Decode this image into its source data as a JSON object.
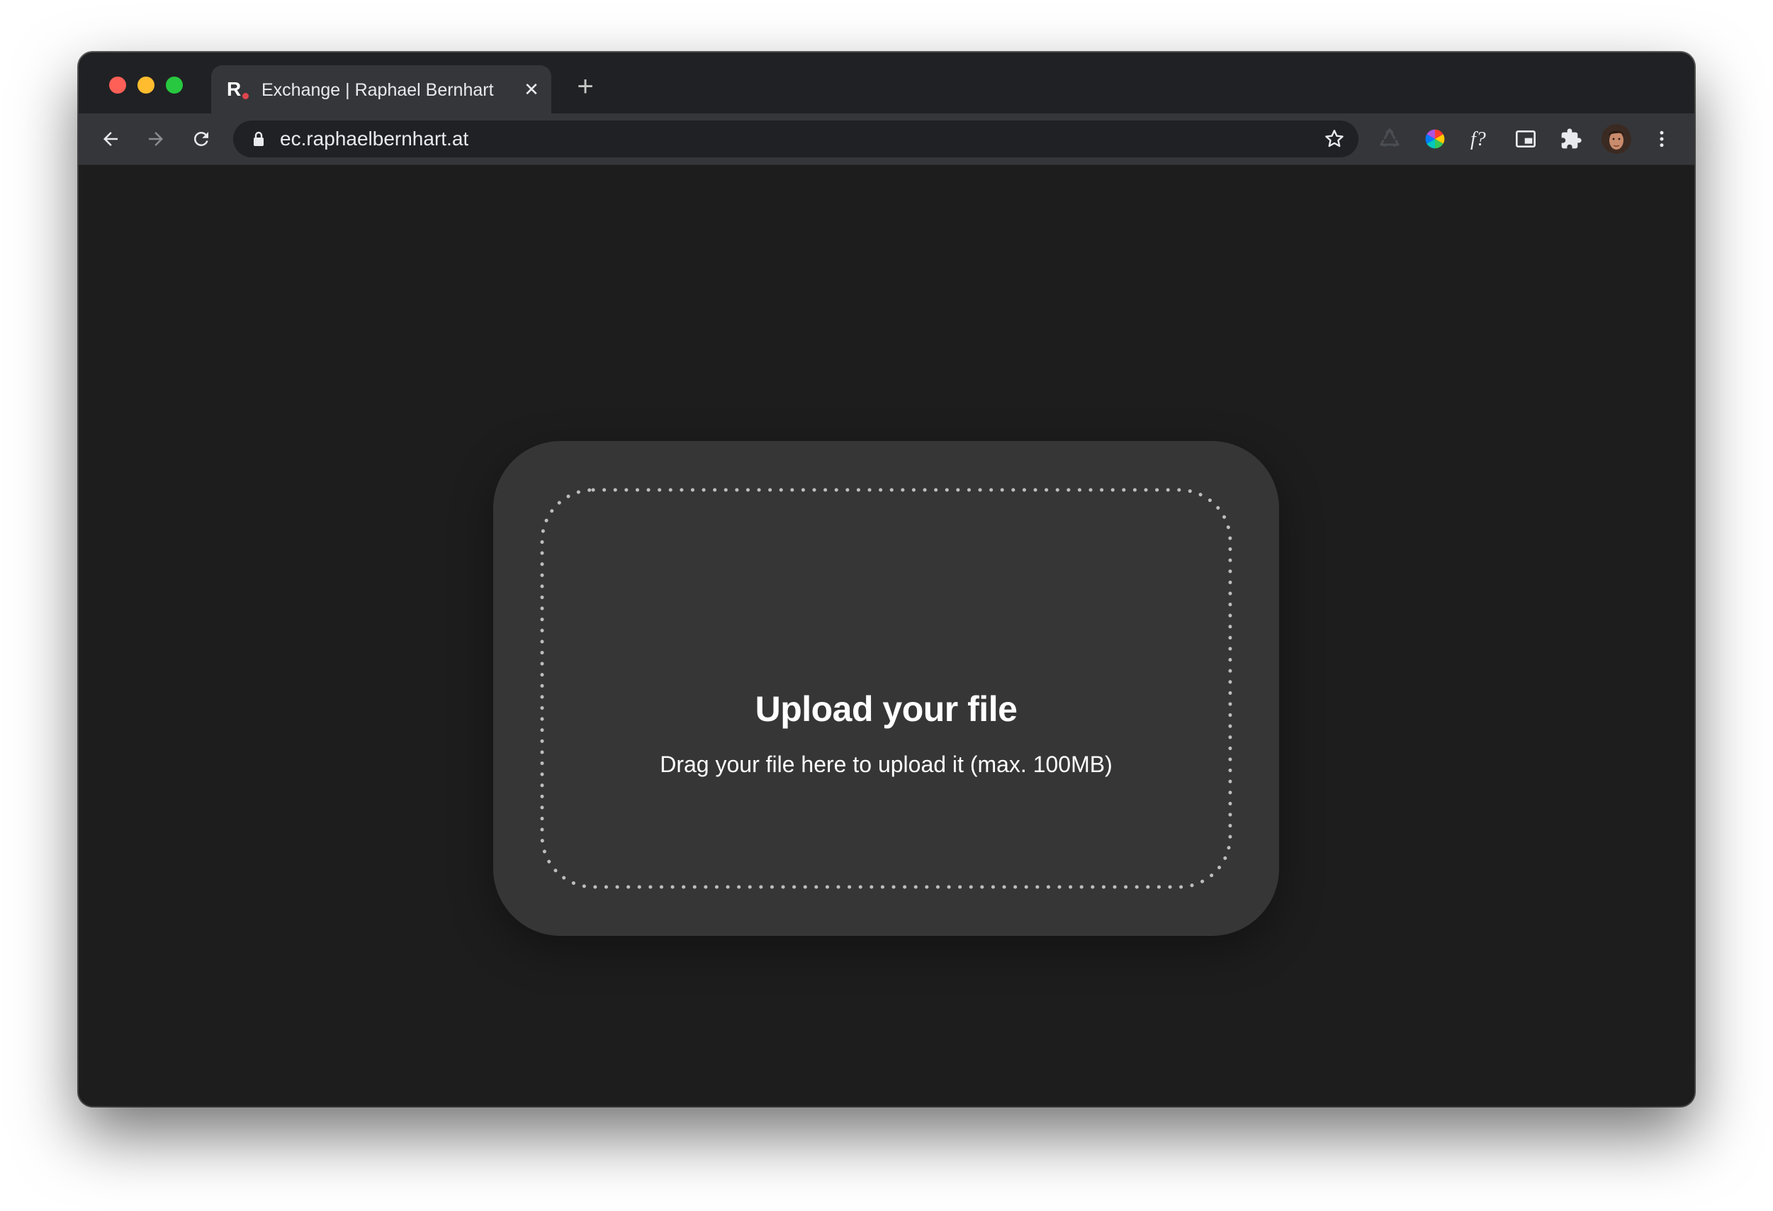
{
  "browser": {
    "tab": {
      "favicon_letter": "R",
      "title": "Exchange | Raphael Bernhart",
      "close_symbol": "✕"
    },
    "new_tab_symbol": "+",
    "address_bar": {
      "url": "ec.raphaelbernhart.at"
    },
    "extension_icons": [
      "recycle-icon",
      "color-wheel-icon",
      "font-question-icon",
      "picture-in-picture-icon",
      "puzzle-icon",
      "profile-avatar",
      "more-vert-icon"
    ]
  },
  "page": {
    "upload": {
      "title": "Upload your file",
      "subtitle": "Drag your file here to upload it (max. 100MB)"
    }
  },
  "colors": {
    "page_background": "#1d1d1d",
    "card_background": "#363636",
    "favicon_dot": "#e0454d"
  }
}
